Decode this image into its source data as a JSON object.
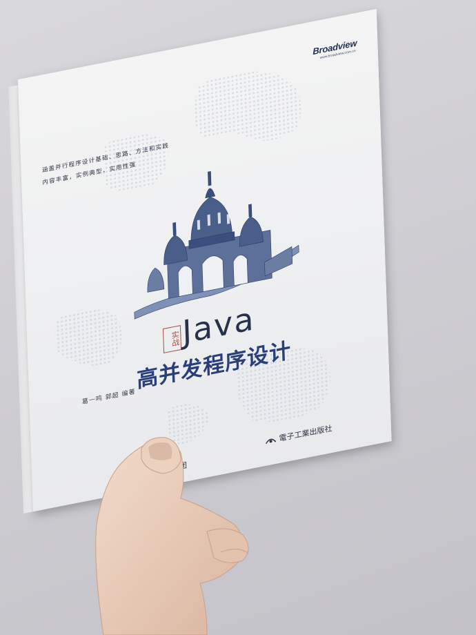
{
  "publisher": {
    "logo_text": "Broadview",
    "url_text": "www.broadview.com.cn"
  },
  "tagline": {
    "line1": "涵盖并行程序设计基础、思路、方法和实践",
    "line2": "内容丰富，实例典型，实用性强"
  },
  "title": {
    "stamp": "实战",
    "java": "Java",
    "main": "高并发程序设计"
  },
  "authors": "葛一鸣  郭超  编著",
  "footer": {
    "group_name": "中国工信出版集团",
    "press_name": "電子工業出版社"
  },
  "colors": {
    "background": "#d2d1d6",
    "cover": "#f1f1f2",
    "title_blue": "#2a3e7a",
    "stamp_red": "#a24b3f",
    "illustration_blue": "#3a4f7e"
  }
}
